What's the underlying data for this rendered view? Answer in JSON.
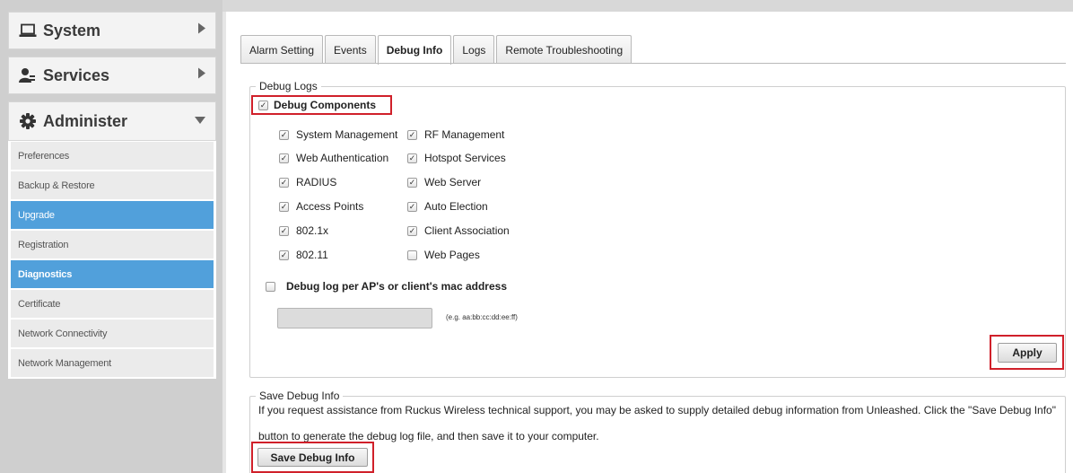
{
  "sidebar": {
    "sections": [
      {
        "label": "System",
        "icon": "laptop-icon",
        "arrow": "collapsed"
      },
      {
        "label": "Services",
        "icon": "services-icon",
        "arrow": "collapsed"
      },
      {
        "label": "Administer",
        "icon": "gear-icon",
        "arrow": "expanded"
      }
    ],
    "admin_items": [
      {
        "label": "Preferences"
      },
      {
        "label": "Backup & Restore"
      },
      {
        "label": "Upgrade"
      },
      {
        "label": "Registration"
      },
      {
        "label": "Diagnostics"
      },
      {
        "label": "Certificate"
      },
      {
        "label": "Network Connectivity"
      },
      {
        "label": "Network Management"
      }
    ],
    "highlighted_items": [
      "Upgrade",
      "Diagnostics"
    ],
    "selected_item": "Diagnostics"
  },
  "tabs": [
    {
      "label": "Alarm Setting"
    },
    {
      "label": "Events"
    },
    {
      "label": "Debug Info"
    },
    {
      "label": "Logs"
    },
    {
      "label": "Remote Troubleshooting"
    }
  ],
  "active_tab": "Debug Info",
  "debug_logs": {
    "legend": "Debug Logs",
    "debug_components_label": "Debug Components",
    "debug_components_checked": true,
    "components": [
      {
        "label": "System Management",
        "checked": true
      },
      {
        "label": "RF Management",
        "checked": true
      },
      {
        "label": "Web Authentication",
        "checked": true
      },
      {
        "label": "Hotspot Services",
        "checked": true
      },
      {
        "label": "RADIUS",
        "checked": true
      },
      {
        "label": "Web Server",
        "checked": true
      },
      {
        "label": "Access Points",
        "checked": true
      },
      {
        "label": "Auto Election",
        "checked": true
      },
      {
        "label": "802.1x",
        "checked": true
      },
      {
        "label": "Client Association",
        "checked": true
      },
      {
        "label": "802.11",
        "checked": true
      },
      {
        "label": "Web Pages",
        "checked": false
      }
    ],
    "mac_label": "Debug log per AP's or client's mac address",
    "mac_checked": false,
    "mac_value": "",
    "mac_hint": "(e.g. aa:bb:cc:dd:ee:ff)",
    "apply_label": "Apply"
  },
  "save_info": {
    "legend": "Save Debug Info",
    "description": "If you request assistance from Ruckus Wireless technical support, you may be asked to supply detailed debug information from Unleashed. Click the \"Save Debug Info\" button to generate the debug log file, and then save it to your computer.",
    "button_label": "Save Debug Info"
  },
  "colors": {
    "accent": "#51a0db",
    "highlight_border": "#d0202a"
  }
}
